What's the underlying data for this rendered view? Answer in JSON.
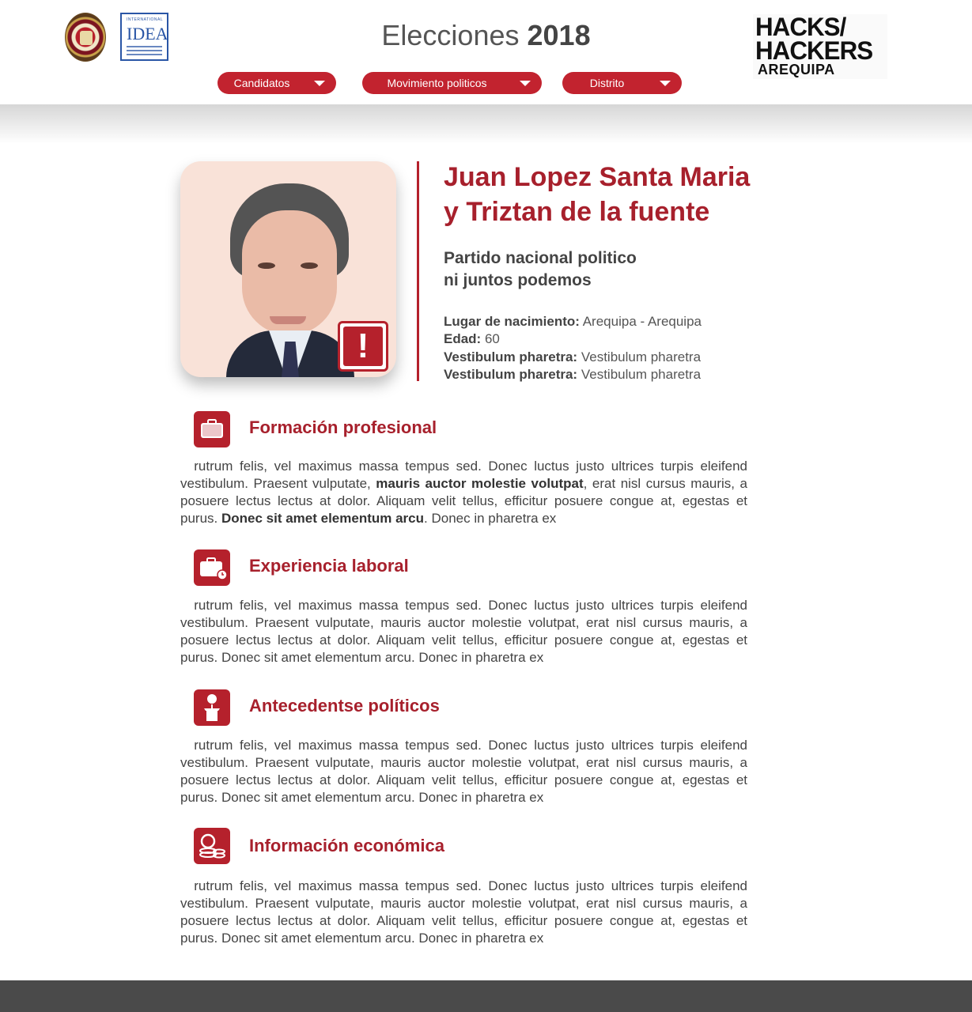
{
  "header": {
    "title_prefix": "Elecciones",
    "title_year": "2018",
    "nav": [
      {
        "label": "Candidatos"
      },
      {
        "label": "Movimiento politicos"
      },
      {
        "label": "Distrito"
      }
    ],
    "idea_logo": {
      "top": "INTERNATIONAL",
      "big": "IDEA"
    },
    "hh_logo": {
      "line1": "HACKS/",
      "line2": "HACKERS",
      "line3": "AREQUIPA"
    }
  },
  "candidate": {
    "name_line1": "Juan Lopez Santa Maria",
    "name_line2": "y Triztan de la fuente",
    "party_line1": "Partido nacional politico",
    "party_line2": "ni juntos podemos",
    "alert_symbol": "!",
    "facts": [
      {
        "label": "Lugar de nacimiento:",
        "value": "Arequipa - Arequipa"
      },
      {
        "label": "Edad:",
        "value": "60"
      },
      {
        "label": "Vestibulum pharetra:",
        "value": "Vestibulum pharetra"
      },
      {
        "label": "Vestibulum pharetra:",
        "value": "Vestibulum pharetra"
      }
    ]
  },
  "sections": [
    {
      "title": "Formación profesional",
      "icon": "briefcase-icon",
      "p1": "rutrum felis, vel maximus massa tempus sed. Donec luctus justo ultrices turpis eleifend vestibulum. Praesent vulputate, ",
      "b1": "mauris auctor molestie volutpat",
      "p2": ", erat nisl cursus mauris, a posuere lectus lectus at dolor. Aliquam velit tellus, efficitur posuere congue at, egestas et purus. ",
      "b2": "Donec sit amet elementum arcu",
      "p3": ". Donec in pharetra ex"
    },
    {
      "title": "Experiencia laboral",
      "icon": "briefcase-clock-icon",
      "text": "rutrum felis, vel maximus massa tempus sed. Donec luctus justo ultrices turpis eleifend vestibulum. Praesent vulputate, mauris auctor molestie volutpat, erat nisl cursus mauris, a posuere lectus lectus at dolor. Aliquam velit tellus, efficitur posuere congue at, egestas et purus. Donec sit amet elementum arcu. Donec in pharetra ex"
    },
    {
      "title": "Antecedentse políticos",
      "icon": "podium-speaker-icon",
      "text": "rutrum felis, vel maximus massa tempus sed. Donec luctus justo ultrices turpis eleifend vestibulum. Praesent vulputate, mauris auctor molestie volutpat, erat nisl cursus mauris, a posuere lectus lectus at dolor. Aliquam velit tellus, efficitur posuere congue at, egestas et purus. Donec sit amet elementum arcu. Donec in pharetra ex"
    },
    {
      "title": "Información económica",
      "icon": "coins-icon",
      "text": "rutrum felis, vel maximus massa tempus sed. Donec luctus justo ultrices turpis eleifend vestibulum. Praesent vulputate, mauris auctor molestie volutpat, erat nisl cursus mauris, a posuere lectus lectus at dolor. Aliquam velit tellus, efficitur posuere congue at, egestas et purus. Donec sit amet elementum arcu. Donec in pharetra ex"
    }
  ],
  "colors": {
    "accent": "#b5212c",
    "nav": "#c2232f",
    "footer": "#4a4a4a"
  }
}
